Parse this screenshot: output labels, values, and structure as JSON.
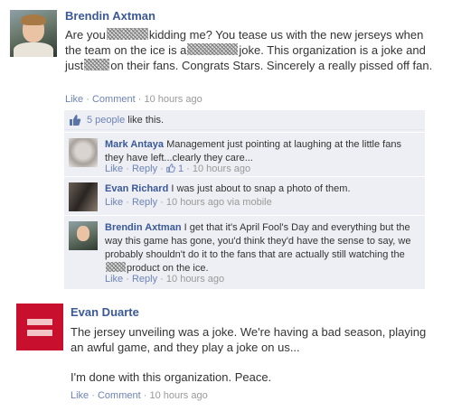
{
  "post1": {
    "author": "Brendin Axtman",
    "text_parts": [
      "Are you",
      "kidding me? You tease us with the new jerseys when the team on the ice is a",
      "joke. This organization is a joke and just",
      "on their fans. Congrats Stars. Sincerely a really pissed off fan."
    ],
    "like_label": "Like",
    "comment_label": "Comment",
    "sep": "·",
    "time": "10 hours ago"
  },
  "likes": {
    "count_text": "5 people",
    "suffix": " like this."
  },
  "comments": [
    {
      "author": "Mark Antaya",
      "text": "Management just pointing at laughing at the little fans they have left...clearly they care...",
      "like_label": "Like",
      "reply_label": "Reply",
      "like_count": "1",
      "time": "10 hours ago"
    },
    {
      "author": "Evan Richard",
      "text": "I was just about to snap a photo of them.",
      "like_label": "Like",
      "reply_label": "Reply",
      "time": "10 hours ago via mobile"
    },
    {
      "author": "Brendin Axtman",
      "text_parts": [
        "I get that it's April Fool's Day and everything but the way this game has gone, you'd think they'd have the sense to say, we probably shouldn't do it to the fans that are actually still watching the",
        "product on the ice."
      ],
      "like_label": "Like",
      "reply_label": "Reply",
      "time": "10 hours ago"
    }
  ],
  "post2": {
    "author": "Evan Duarte",
    "line1": "The jersey unveiling was a joke. We're having a bad season, playing an awful game, and they play a joke on us...",
    "line2": "I'm done with this organization. Peace.",
    "like_label": "Like",
    "comment_label": "Comment",
    "time": "10 hours ago"
  },
  "colors": {
    "link": "#3b5998",
    "action_link": "#6d84b4",
    "comment_bg": "#edeff4",
    "hrc_red": "#c8102e"
  },
  "icons": [
    "thumbs-up-icon",
    "censored-blur"
  ]
}
